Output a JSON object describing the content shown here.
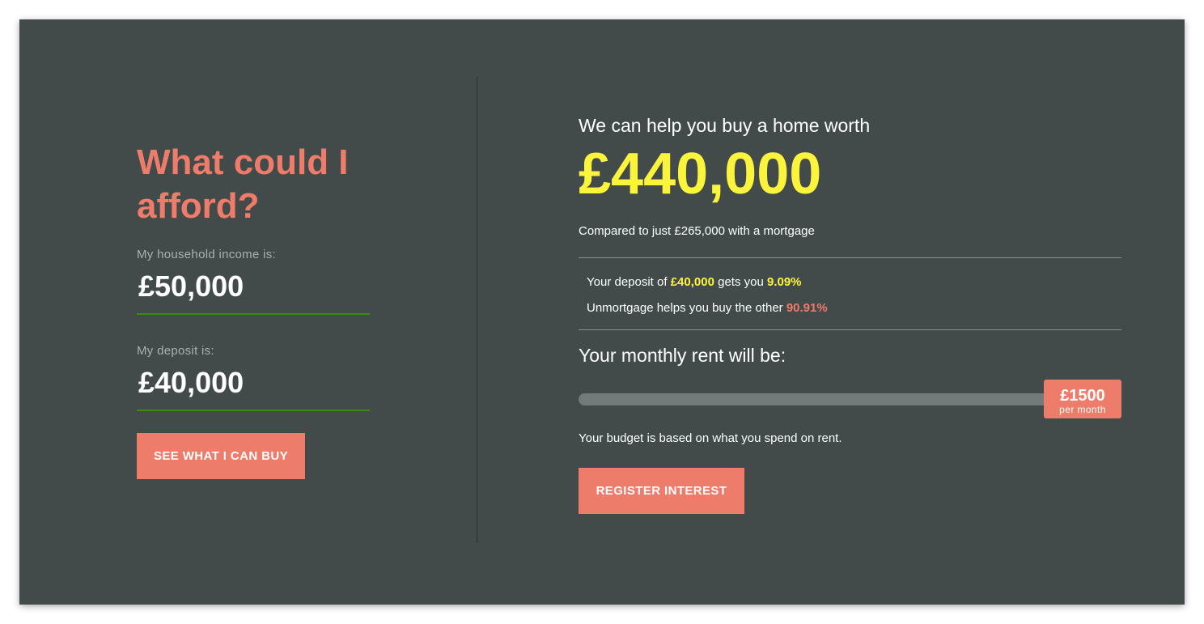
{
  "colors": {
    "panel_bg": "#434a4a",
    "accent_coral": "#ee7c6b",
    "accent_yellow": "#fbf43c",
    "input_underline": "#3c8a16"
  },
  "affordability": {
    "heading": "What could I afford?",
    "income_label": "My household income is:",
    "income_value": "£50,000",
    "deposit_label": "My deposit is:",
    "deposit_value": "£40,000",
    "see_button": "SEE WHAT I CAN BUY"
  },
  "result": {
    "subhead": "We can help you buy a home worth",
    "home_value": "£440,000",
    "compare_text": "Compared to just £265,000 with a mortgage",
    "deposit_line": {
      "prefix": "Your deposit of ",
      "deposit": "£40,000",
      "middle": " gets you ",
      "percent": "9.09%"
    },
    "unmortgage_line": {
      "prefix": "Unmortgage helps you buy the other ",
      "percent": "90.91%"
    },
    "rent_heading": "Your monthly rent will be:",
    "rent_slider": {
      "value": "£1500",
      "unit": "per month",
      "fraction": 1.0
    },
    "budget_note": "Your budget is based on what you spend on rent.",
    "register_button": "REGISTER INTEREST"
  }
}
